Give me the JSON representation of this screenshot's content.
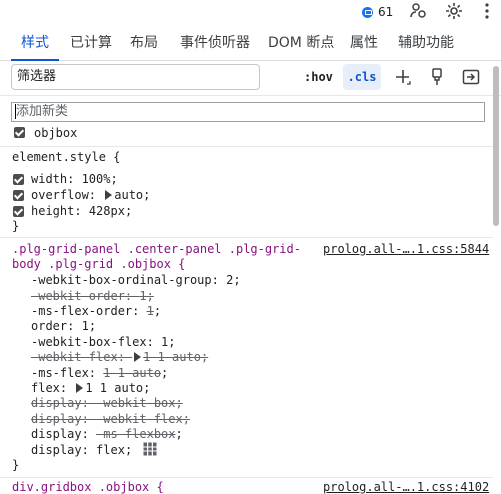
{
  "topbar": {
    "message_count": "61"
  },
  "tabs": [
    "样式",
    "已计算",
    "布局",
    "事件侦听器",
    "DOM 断点",
    "属性",
    "辅助功能"
  ],
  "filter": {
    "placeholder": "筛选器",
    "hov": ":hov",
    "cls": ".cls"
  },
  "new_class_placeholder": "添加新类",
  "class_toggle": "objbox",
  "element_style": {
    "header": "element.style {",
    "props": [
      {
        "name": "width",
        "value": "100%"
      },
      {
        "name": "overflow",
        "value": "auto"
      },
      {
        "name": "height",
        "value": "428px"
      }
    ],
    "close": "}"
  },
  "rule1": {
    "selector_line1": ".plg-grid-panel .center-panel .plg-grid-",
    "selector_line2": "body .plg-grid .objbox {",
    "source": "prolog.all-….1.css:5844",
    "props": [
      {
        "name": "-webkit-box-ordinal-group",
        "value": "2",
        "struck": false
      },
      {
        "name": "-webkit-order",
        "value": "1",
        "struck": true
      },
      {
        "name": "-ms-flex-order",
        "value": "1",
        "struck": false,
        "value_struck": true
      },
      {
        "name": "order",
        "value": "1",
        "struck": false
      },
      {
        "name": "-webkit-box-flex",
        "value": "1",
        "struck": false
      },
      {
        "name": "-webkit-flex",
        "value": "1 1 auto",
        "struck": true
      },
      {
        "name": "-ms-flex",
        "value": "1 1 auto",
        "struck": false,
        "value_struck": true
      },
      {
        "name": "flex",
        "value": "1 1 auto",
        "struck": false
      },
      {
        "name": "display",
        "value": "-webkit-box",
        "struck": true
      },
      {
        "name": "display",
        "value": "-webkit-flex",
        "struck": true
      },
      {
        "name": "display",
        "value": "-ms-flexbox",
        "struck": false,
        "value_struck": true
      },
      {
        "name": "display",
        "value": "flex",
        "struck": false
      }
    ],
    "close": "}"
  },
  "rule2": {
    "selector_line1": "div.gridbox .objbox {",
    "source": "prolog.all-….1.css:4102"
  }
}
